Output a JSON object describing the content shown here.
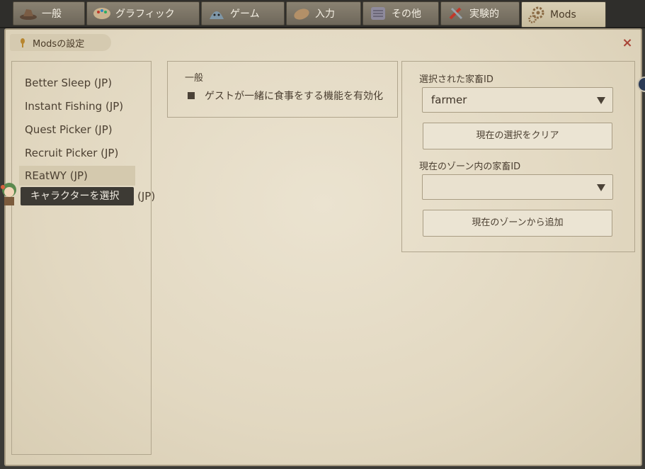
{
  "tabs": [
    {
      "label": "一般",
      "icon": "hat-icon"
    },
    {
      "label": "グラフィック",
      "icon": "palette-icon"
    },
    {
      "label": "ゲーム",
      "icon": "slime-icon"
    },
    {
      "label": "入力",
      "icon": "mitten-icon"
    },
    {
      "label": "その他",
      "icon": "tablet-icon"
    },
    {
      "label": "実験的",
      "icon": "tools-icon"
    },
    {
      "label": "Mods",
      "icon": "gears-icon"
    }
  ],
  "window": {
    "title": "Modsの設定",
    "close": "×"
  },
  "mod_list": {
    "items": [
      "Better Sleep (JP)",
      "Instant Fishing (JP)",
      "Quest Picker (JP)",
      "Recruit Picker (JP)",
      "REatWY (JP)"
    ],
    "selected_index": 4,
    "partial_item_visible": "(JP)"
  },
  "tooltip": "キャラクターを選択",
  "general": {
    "title": "一般",
    "option_label": "ゲストが一緒に食事をする機能を有効化"
  },
  "right": {
    "selected_label": "選択された家畜ID",
    "selected_value": "farmer",
    "clear_button": "現在の選択をクリア",
    "zone_label": "現在のゾーン内の家畜ID",
    "zone_value": "",
    "add_button": "現在のゾーンから追加"
  },
  "colors": {
    "panel_bg": "#e6ddc8",
    "text": "#4b3f31",
    "accent_close": "#a84436",
    "tab_active": "#d9cfb4"
  }
}
